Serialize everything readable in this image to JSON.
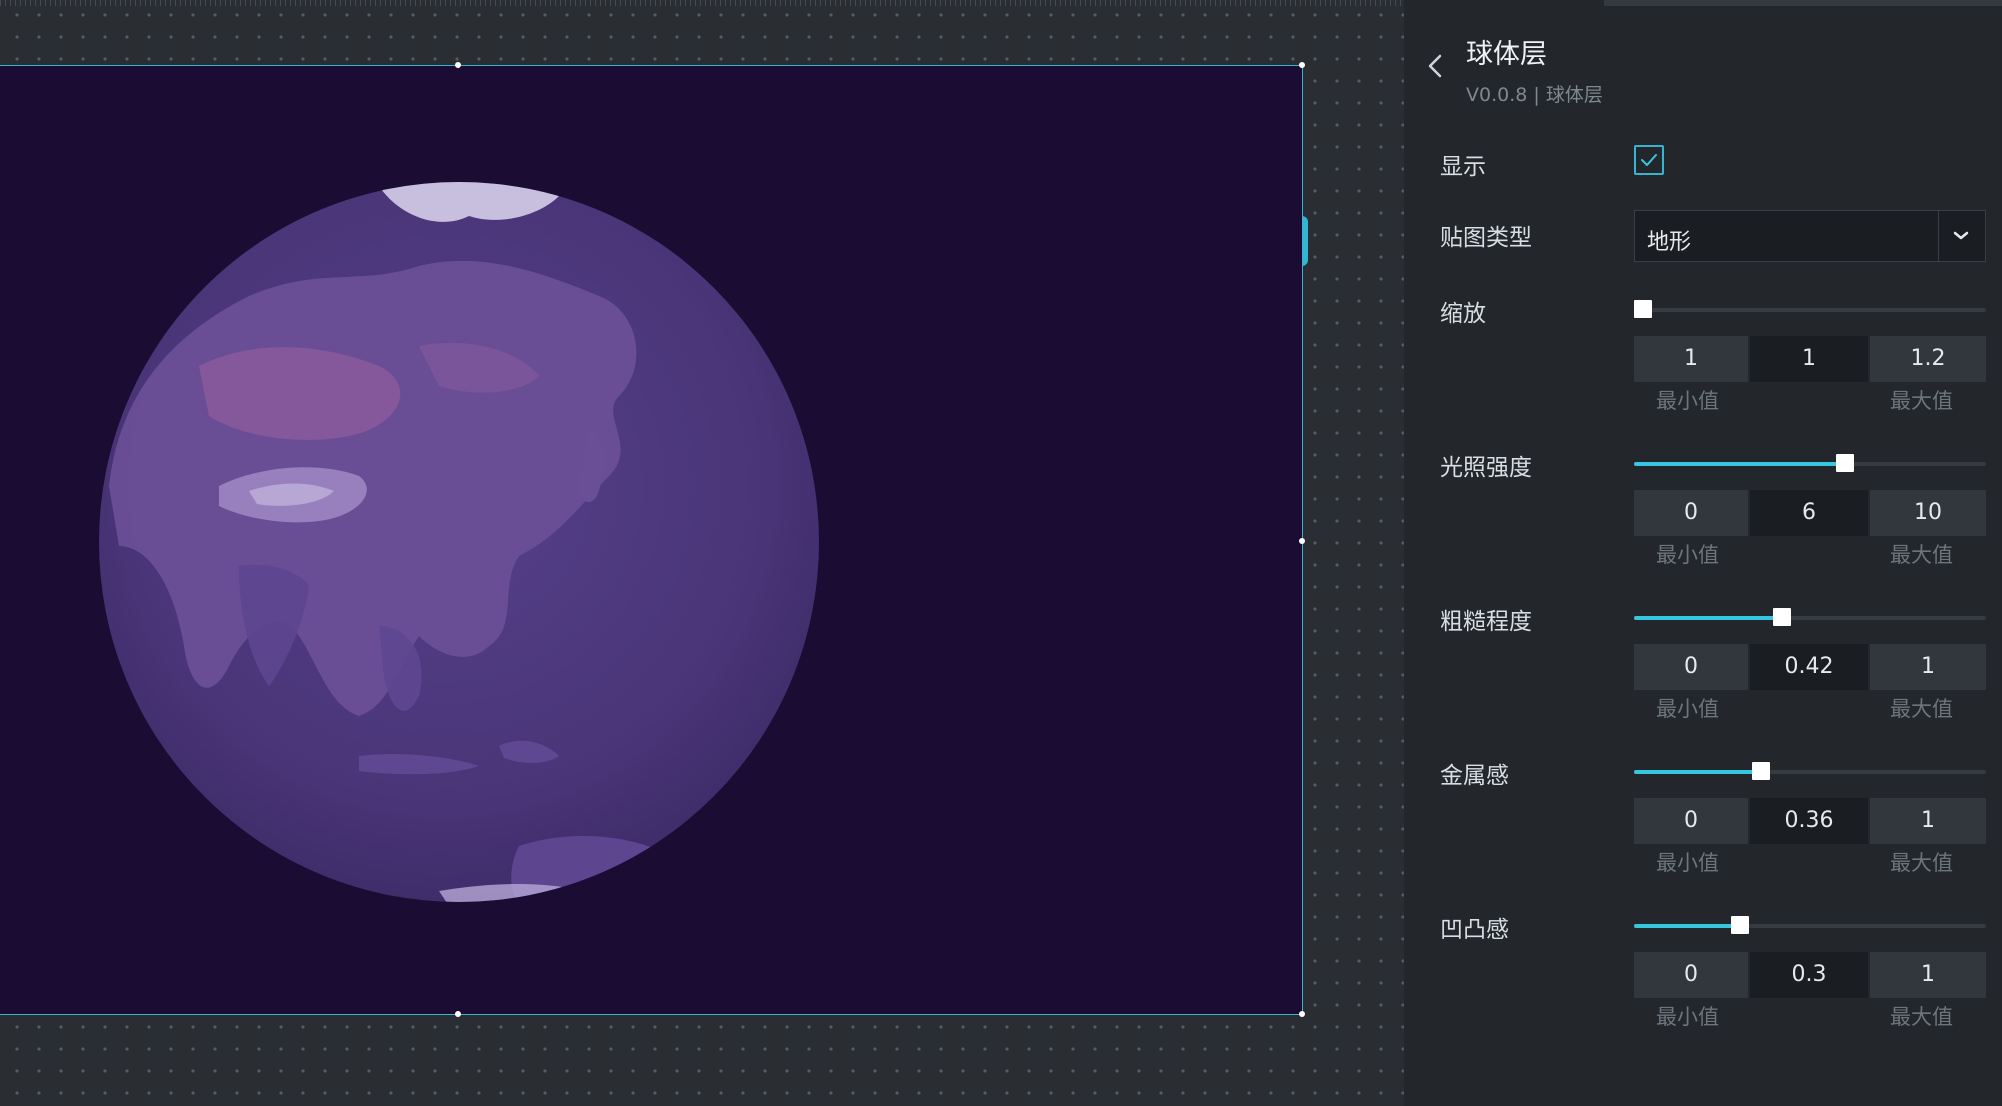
{
  "panel": {
    "title": "球体层",
    "subtitle": "V0.0.8 | 球体层"
  },
  "display": {
    "label": "显示",
    "checked": true
  },
  "map_type": {
    "label": "贴图类型",
    "value": "地形"
  },
  "captions": {
    "min": "最小值",
    "max": "最大值"
  },
  "sliders": [
    {
      "label": "缩放",
      "min": "1",
      "value": "1",
      "max": "1.2",
      "fraction": 0.0
    },
    {
      "label": "光照强度",
      "min": "0",
      "value": "6",
      "max": "10",
      "fraction": 0.6
    },
    {
      "label": "粗糙程度",
      "min": "0",
      "value": "0.42",
      "max": "1",
      "fraction": 0.42
    },
    {
      "label": "金属感",
      "min": "0",
      "value": "0.36",
      "max": "1",
      "fraction": 0.36
    },
    {
      "label": "凹凸感",
      "min": "0",
      "value": "0.3",
      "max": "1",
      "fraction": 0.3
    }
  ],
  "colors": {
    "accent": "#36c6e0",
    "canvas_background": "#1b0c33",
    "globe": "#4b3578",
    "panel_background": "#23272c"
  },
  "icons": [
    "back-arrow-icon",
    "checkmark-icon",
    "chevron-down-icon"
  ]
}
